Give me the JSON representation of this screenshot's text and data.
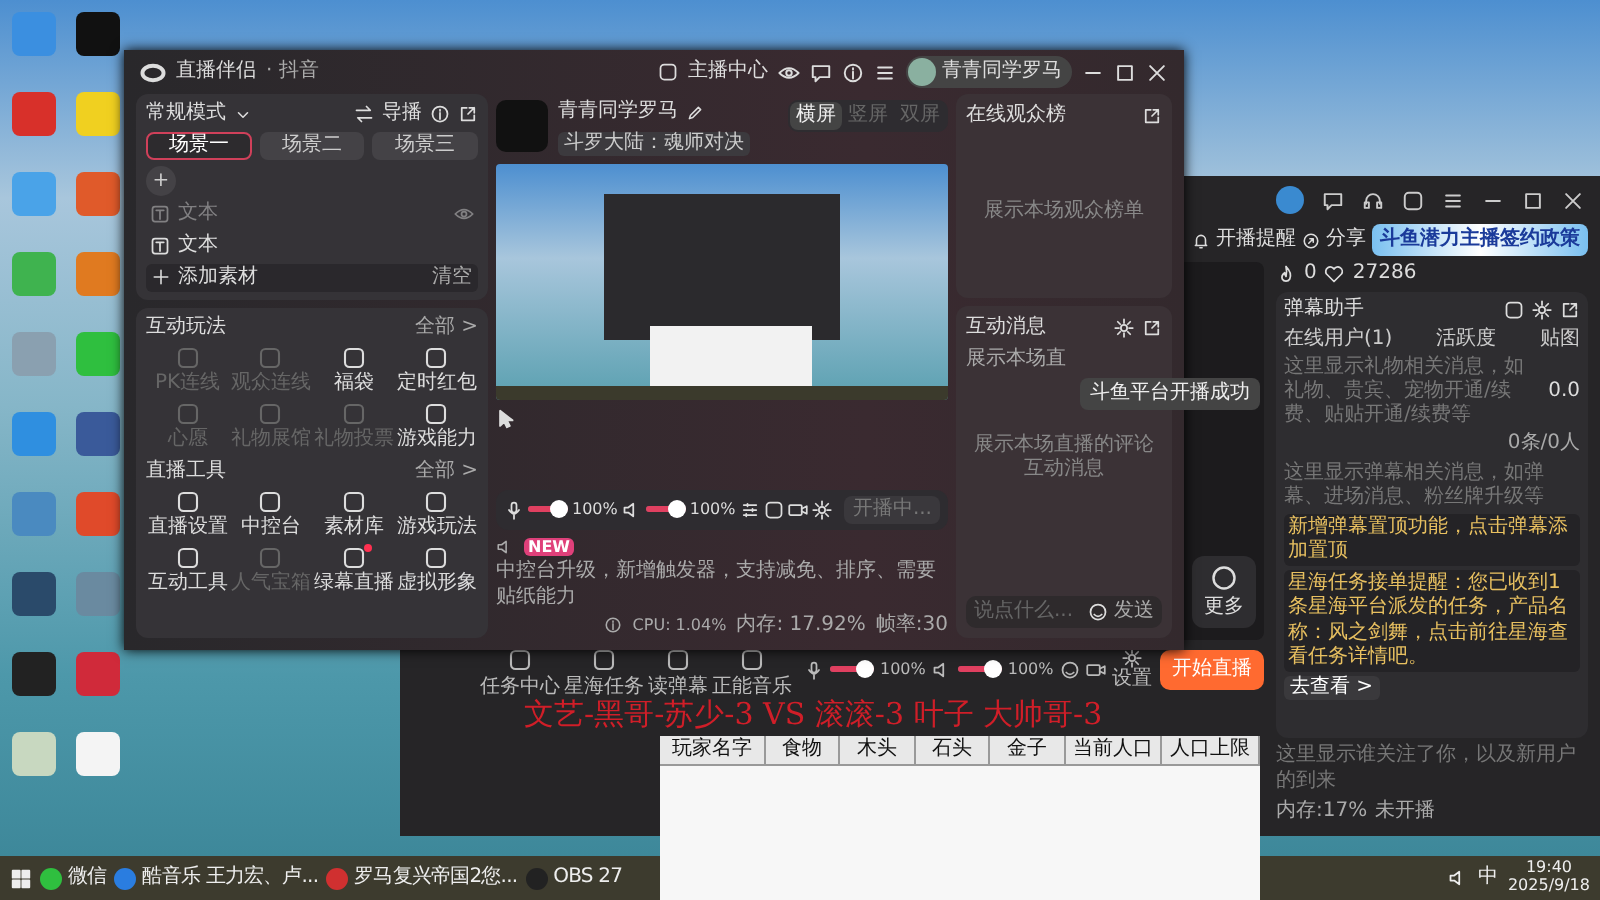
{
  "desktop": {
    "icons": [
      {
        "color": "#3b8fe0"
      },
      {
        "color": "#d8302a"
      },
      {
        "color": "#4aa3e8"
      },
      {
        "color": "#3fb34f"
      },
      {
        "color": "#8aa0b0"
      },
      {
        "color": "#2f8fe0"
      },
      {
        "color": "#4a8ac0"
      },
      {
        "color": "#2a4a6a"
      },
      {
        "color": "#222222"
      },
      {
        "color": "#c8d8c0"
      },
      {
        "color": "#111111"
      },
      {
        "color": "#f0d020"
      },
      {
        "color": "#e05a2a"
      },
      {
        "color": "#e07a20"
      },
      {
        "color": "#2fbf3f"
      },
      {
        "color": "#3a5a9a"
      },
      {
        "color": "#e04a2a"
      },
      {
        "color": "#6a8aa0"
      },
      {
        "color": "#d02a3a"
      },
      {
        "color": "#f4f4f4"
      }
    ]
  },
  "back_window": {
    "sidebar_tools": [
      {
        "label": "任务中心"
      },
      {
        "label": "星海任务"
      },
      {
        "label": "读弹幕"
      },
      {
        "label": "正能音乐"
      }
    ],
    "reminder": "开播提醒",
    "share": "分享",
    "banner": "斗鱼潜力主播签约政策",
    "flames": "0",
    "likes": "27286",
    "more": "更多",
    "controls": [
      {
        "kind": "icon"
      },
      {
        "kind": "slider",
        "level": 1,
        "reading": "100%"
      },
      {
        "kind": "icon"
      },
      {
        "kind": "slider",
        "level": 1,
        "reading": "100%"
      },
      {
        "kind": "icon"
      },
      {
        "kind": "icon"
      },
      {
        "kind": "icon",
        "label": "设置"
      }
    ],
    "start": "开始直播",
    "stats": [
      "内存:17%",
      "未开播"
    ],
    "danmu": {
      "title": "弹幕助手",
      "tabs": [
        "在线用户(1)",
        "活跃度",
        "贴图"
      ],
      "gift_hint": "这里显示礼物相关消息，如礼物、贵宾、宠物开通/续费、贴贴开通/续费等",
      "gift_value": "0.0",
      "count": "0条/0人",
      "danmu_hint": "这里显示弹幕相关消息，如弹幕、进场消息、粉丝牌升级等",
      "notices": [
        "新增弹幕置顶功能，点击弹幕添加置顶",
        "星海任务接单提醒：您已收到1条星海平台派发的任务，产品名称：风之剑舞，点击前往星海查看任务详情吧。"
      ],
      "action": "去查看 >"
    },
    "follow_hint": "这里显示谁关注了你，以及新用户的到来"
  },
  "main_window": {
    "title": "直播伴侣",
    "subtitle": "· 抖音",
    "center_link": "主播中心",
    "user": "青青同学罗马",
    "scene_panel": {
      "mode": "常规模式",
      "director": "导播",
      "scenes": [
        {
          "label": "场景一",
          "selected": true
        },
        {
          "label": "场景二",
          "selected": false
        },
        {
          "label": "场景三",
          "selected": false
        }
      ],
      "add_scene": "+",
      "sources": [
        {
          "label": "文本",
          "hidden": true
        },
        {
          "label": "文本",
          "hidden": false
        }
      ],
      "add_source": "添加素材",
      "clear": "清空"
    },
    "interactive": {
      "title": "互动玩法",
      "more": "全部 >",
      "items": [
        {
          "label": "PK连线",
          "disabled": true,
          "badge": false
        },
        {
          "label": "观众连线",
          "disabled": true,
          "badge": false
        },
        {
          "label": "福袋",
          "disabled": false,
          "badge": false
        },
        {
          "label": "定时红包",
          "disabled": false,
          "badge": false
        },
        {
          "label": "心愿",
          "disabled": true,
          "badge": false
        },
        {
          "label": "礼物展馆",
          "disabled": true,
          "badge": false
        },
        {
          "label": "礼物投票",
          "disabled": true,
          "badge": false
        },
        {
          "label": "游戏能力",
          "disabled": false,
          "badge": false
        }
      ]
    },
    "tools": {
      "title": "直播工具",
      "more": "全部 >",
      "items": [
        {
          "label": "直播设置",
          "disabled": false,
          "badge": false
        },
        {
          "label": "中控台",
          "disabled": false,
          "badge": false
        },
        {
          "label": "素材库",
          "disabled": false,
          "badge": false
        },
        {
          "label": "游戏玩法",
          "disabled": false,
          "badge": false
        },
        {
          "label": "互动工具",
          "disabled": false,
          "badge": false
        },
        {
          "label": "人气宝箱",
          "disabled": true,
          "badge": false
        },
        {
          "label": "绿幕直播",
          "disabled": false,
          "badge": true
        },
        {
          "label": "虚拟形象",
          "disabled": false,
          "badge": false
        }
      ]
    },
    "stream": {
      "name": "青青同学罗马",
      "game": "斗罗大陆：魂师对决",
      "layouts": [
        {
          "label": "横屏",
          "selected": true
        },
        {
          "label": "竖屏",
          "selected": false
        },
        {
          "label": "双屏",
          "selected": false
        }
      ]
    },
    "controls": {
      "mic": {
        "level": 1,
        "reading": "100%"
      },
      "speaker": {
        "level": 1,
        "reading": "100%"
      },
      "start": "开播中..."
    },
    "status": {
      "badge": "NEW",
      "message": "中控台升级，新增触发器，支持减免、排序、需要贴纸能力",
      "cpu": "CPU: 1.04%",
      "memory": "内存: 17.92%",
      "fps": "帧率:30"
    },
    "audience": {
      "title": "在线观众榜",
      "empty": "展示本场观众榜单"
    },
    "messages": {
      "title": "互动消息",
      "notice": "展示本场直",
      "empty": "展示本场直播的评论互动消息",
      "placeholder": "说点什么...",
      "send": "发送"
    },
    "toast": "斗鱼平台开播成功"
  },
  "overlay_text": "文艺-黑哥-苏少-3 VS 滚滚-3 叶子 大帅哥-3",
  "table_window": {
    "columns": [
      "玩家名字",
      "食物",
      "木头",
      "石头",
      "金子",
      "当前人口",
      "人口上限"
    ]
  },
  "taskbar": {
    "items": [
      {
        "label": "微信",
        "color": "#2fbf3f"
      },
      {
        "label": "酷音乐 王力宏、卢...",
        "color": "#2a7de0"
      },
      {
        "label": "罗马复兴帝国2您...",
        "color": "#d03030"
      },
      {
        "label": "OBS 27",
        "color": "#222222"
      }
    ],
    "ime": "中",
    "time": "19:40",
    "date": "2025/9/18"
  }
}
